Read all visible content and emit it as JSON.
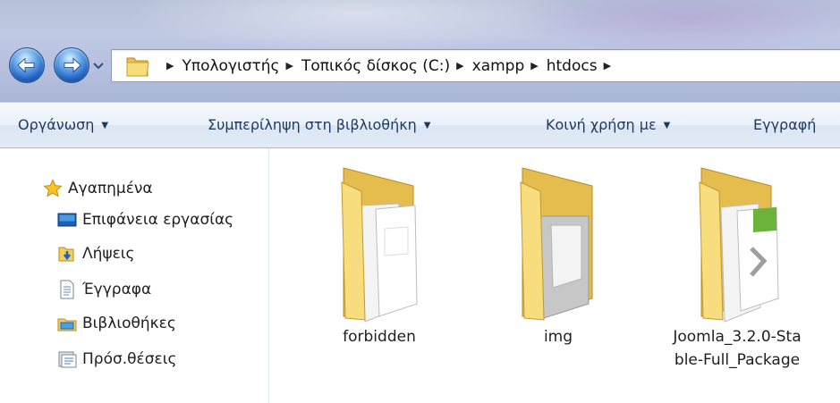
{
  "address": {
    "crumbs": [
      "Υπολογιστής",
      "Τοπικός δίσκος (C:)",
      "xampp",
      "htdocs"
    ]
  },
  "commands": {
    "organize": "Οργάνωση",
    "include_library": "Συμπερίληψη στη βιβλιοθήκη",
    "share_with": "Κοινή χρήση με",
    "burn": "Εγγραφή"
  },
  "navpane": {
    "favorites": "Αγαπημένα",
    "desktop": "Επιφάνεια εργασίας",
    "downloads": "Λήψεις",
    "documents": "Έγγραφα",
    "libraries": "Βιβλιοθήκες",
    "places": "Πρόσ.θέσεις"
  },
  "items": [
    {
      "name": "forbidden",
      "icon": "folder-documents-icon"
    },
    {
      "name": "img",
      "icon": "folder-images-icon"
    },
    {
      "name_line1": "Joomla_3.2.0-Sta",
      "name_line2": "ble-Full_Package",
      "icon": "folder-package-icon"
    }
  ],
  "colors": {
    "command_text": "#1e395b",
    "nav_blue": "#1f5fbf",
    "folder_yellow": "#f3d774"
  }
}
